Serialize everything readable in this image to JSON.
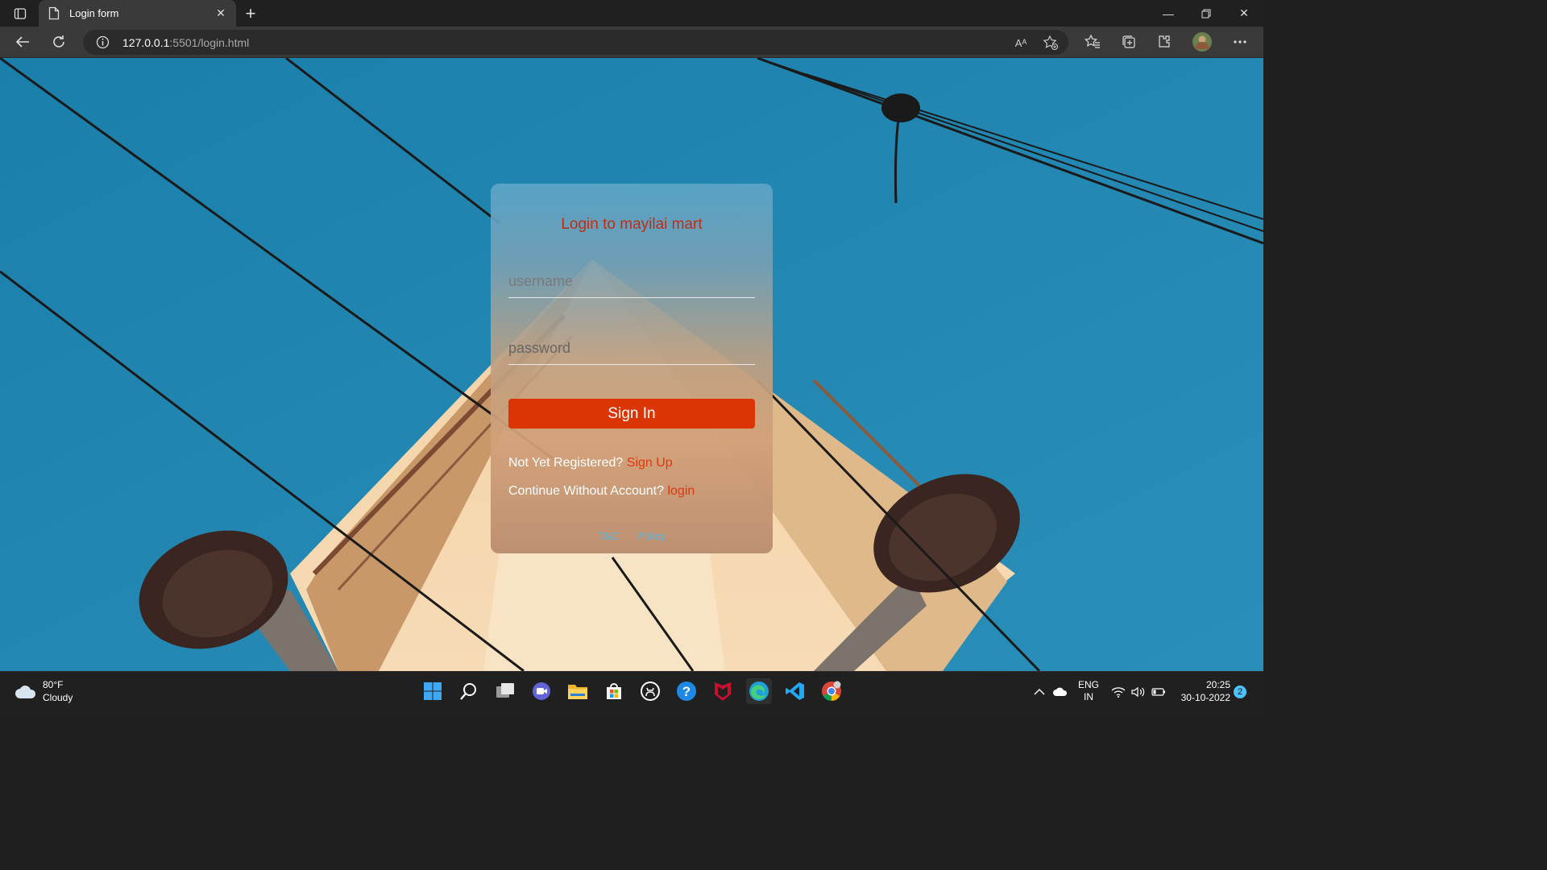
{
  "browser": {
    "tab_title": "Login form",
    "url_host": "127.0.0.1",
    "url_rest": ":5501/login.html",
    "read_aloud_label": "Aᴬ"
  },
  "page": {
    "card_title": "Login to mayilai mart",
    "username_placeholder": "username",
    "password_placeholder": "password",
    "sign_in_label": "Sign In",
    "register_text": "Not Yet Registered?",
    "register_link": "Sign Up",
    "guest_text": "Continue Without Account?",
    "guest_link": "login",
    "footer_tnc": "T&C",
    "footer_policy": "Policy"
  },
  "taskbar": {
    "weather_temp": "80°F",
    "weather_cond": "Cloudy",
    "lang_line1": "ENG",
    "lang_line2": "IN",
    "time": "20:25",
    "date": "30-10-2022",
    "notification_count": "2",
    "apps": [
      "windows-start-icon",
      "search-icon",
      "task-view-icon",
      "teams-chat-icon",
      "file-explorer-icon",
      "microsoft-store-icon",
      "github-icon",
      "help-icon",
      "mcafee-icon",
      "edge-icon",
      "vscode-icon",
      "chrome-icon"
    ]
  },
  "colors": {
    "accent_red": "#db3505",
    "title_red": "#c42b12",
    "link_blue": "#57b6e0",
    "sky": "#1e86b1"
  }
}
